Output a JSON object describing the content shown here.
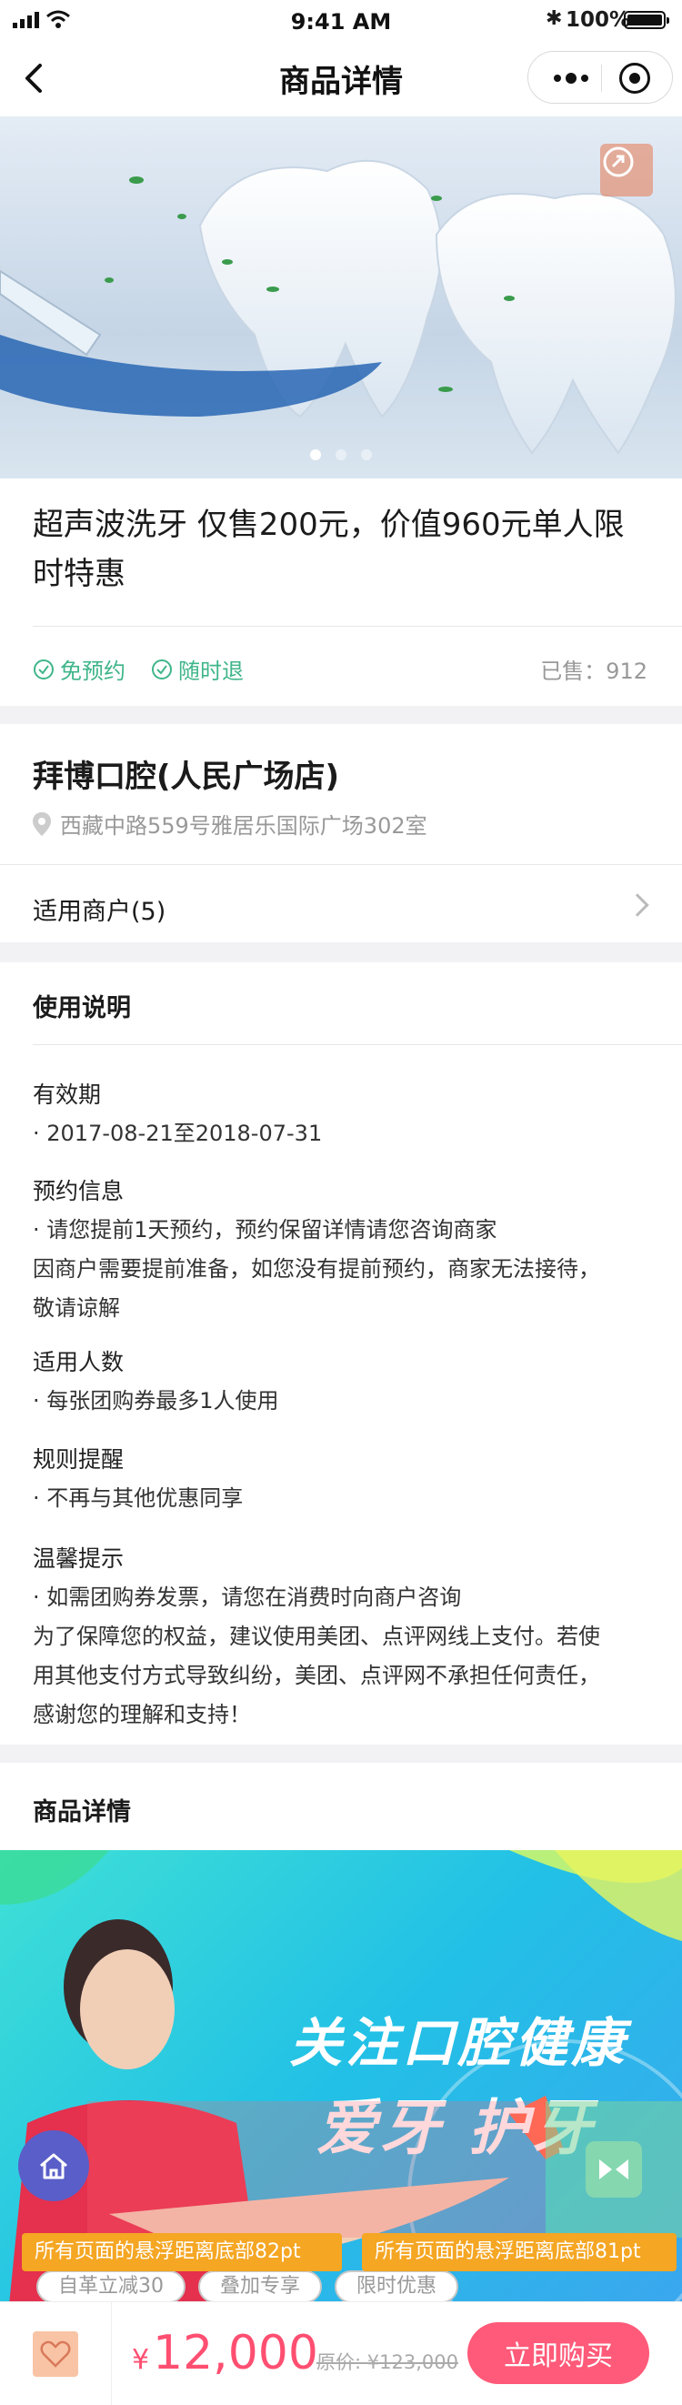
{
  "status_bar": {
    "time": "9:41 AM",
    "battery": "100%"
  },
  "nav": {
    "title": "商品详情"
  },
  "carousel": {
    "slide_count": 3,
    "active_index": 0
  },
  "product": {
    "title": "超声波洗牙 仅售200元，价值960元单人限时特惠",
    "tags": [
      "免预约",
      "随时退"
    ],
    "sold_label": "已售：912"
  },
  "store": {
    "name": "拜博口腔(人民广场店)",
    "address": "西藏中路559号雅居乐国际广场302室",
    "merchants_label": "适用商户(5)"
  },
  "usage": {
    "title": "使用说明",
    "sections": [
      {
        "heading": "有效期",
        "lines": [
          "· 2017-08-21至2018-07-31"
        ]
      },
      {
        "heading": "预约信息",
        "lines": [
          "· 请您提前1天预约，预约保留详情请您咨询商家",
          "因商户需要提前准备，如您没有提前预约，商家无法接待，",
          "敬请谅解"
        ]
      },
      {
        "heading": "适用人数",
        "lines": [
          "· 每张团购券最多1人使用"
        ]
      },
      {
        "heading": "规则提醒",
        "lines": [
          "· 不再与其他优惠同享"
        ]
      },
      {
        "heading": "温馨提示",
        "lines": [
          "· 如需团购券发票，请您在消费时向商户咨询",
          "为了保障您的权益，建议使用美团、点评网线上支付。若使",
          "用其他支付方式导致纠纷，美团、点评网不承担任何责任，",
          "感谢您的理解和支持！"
        ]
      }
    ]
  },
  "detail": {
    "title": "商品详情",
    "banner_line1": "关注口腔健康",
    "banner_line2": "爱牙 护牙"
  },
  "float": {
    "left_label": "所有页面的悬浮距离底部82pt",
    "right_label": "所有页面的悬浮距离底部81pt"
  },
  "chips": [
    "自革立减30",
    "叠加专享",
    "限时优惠"
  ],
  "bottom": {
    "currency": "¥",
    "price": "12,000",
    "original_price": "原价: ¥123,000",
    "buy_label": "立即购买"
  },
  "colors": {
    "accent": "#ff5a79",
    "green": "#3fb58a",
    "float_label": "#f5a623"
  }
}
